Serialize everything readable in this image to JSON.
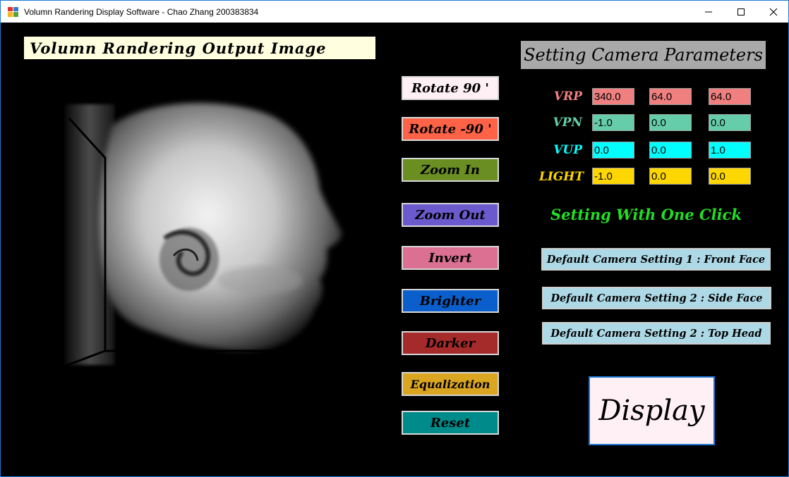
{
  "window": {
    "title": "Volumn Randering Display Software - Chao Zhang 200383834",
    "icon": "app-icon",
    "controls": [
      "minimize-icon",
      "maximize-icon",
      "close-icon"
    ]
  },
  "output": {
    "title": "Volumn Randering Output Image"
  },
  "buttons": [
    {
      "name": "rotate-90-button",
      "label": "Rotate 90 '",
      "color": "#fff0f5"
    },
    {
      "name": "rotate-neg-90-button",
      "label": "Rotate -90 '",
      "color": "#ff6347"
    },
    {
      "name": "zoom-in-button",
      "label": "Zoom In",
      "color": "#6b8e23"
    },
    {
      "name": "zoom-out-button",
      "label": "Zoom Out",
      "color": "#6a5acd"
    },
    {
      "name": "invert-button",
      "label": "Invert",
      "color": "#db7093"
    },
    {
      "name": "brighter-button",
      "label": "Brighter",
      "color": "#0a5fcc"
    },
    {
      "name": "darker-button",
      "label": "Darker",
      "color": "#a52a2a"
    },
    {
      "name": "equalization-button",
      "label": "Equalization",
      "color": "#daa520"
    },
    {
      "name": "reset-button",
      "label": "Reset",
      "color": "#008b8b"
    }
  ],
  "camera": {
    "title": "Setting Camera Parameters",
    "rows": [
      {
        "label": "VRP",
        "label_color": "#f08080",
        "field_color": "#f08080",
        "values": [
          "340.0",
          "64.0",
          "64.0"
        ]
      },
      {
        "label": "VPN",
        "label_color": "#66cdaa",
        "field_color": "#66cdaa",
        "values": [
          "-1.0",
          "0.0",
          "0.0"
        ]
      },
      {
        "label": "VUP",
        "label_color": "#00ffff",
        "field_color": "#00ffff",
        "values": [
          "0.0",
          "0.0",
          "1.0"
        ]
      },
      {
        "label": "LIGHT",
        "label_color": "#ffd700",
        "field_color": "#ffd700",
        "values": [
          "-1.0",
          "0.0",
          "0.0"
        ]
      }
    ]
  },
  "presets": {
    "heading": "Setting With One Click",
    "items": [
      "Default Camera Setting 1 : Front Face",
      "Default Camera Setting 2 : Side Face",
      "Default Camera Setting 2 : Top Head"
    ]
  },
  "display_button": "Display"
}
